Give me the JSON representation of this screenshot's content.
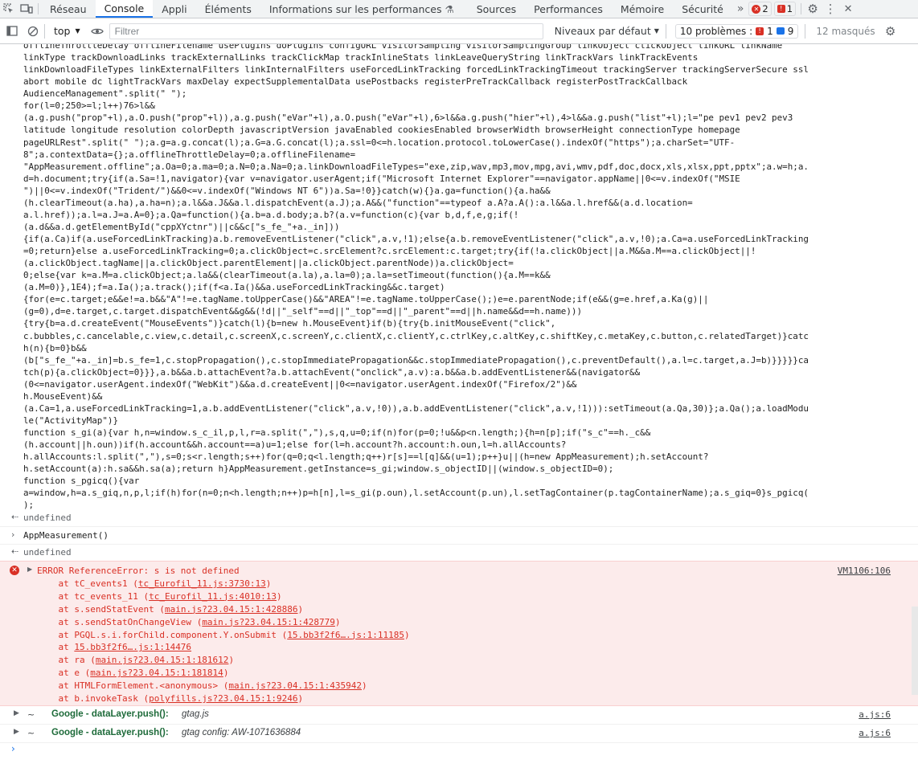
{
  "tabs": [
    "Réseau",
    "Console",
    "Appli",
    "Éléments",
    "Informations sur les performances",
    "Sources",
    "Performances",
    "Mémoire",
    "Sécurité"
  ],
  "active_tab": "Console",
  "badges": {
    "errors": "2",
    "warnings": "1"
  },
  "toolbar": {
    "context": "top",
    "filter_placeholder": "Filtrer",
    "levels": "Niveaux par défaut",
    "problems_label": "10 problèmes :",
    "problems_errors": "1",
    "problems_info": "9",
    "hidden": "12 masqués"
  },
  "code_text": "offlineThrottleDelay offlineFilename usePlugins doPlugins configURL visitorSampling visitorSamplingGroup linkObject clickObject linkURL linkName\nlinkType trackDownloadLinks trackExternalLinks trackClickMap trackInlineStats linkLeaveQueryString linkTrackVars linkTrackEvents\nlinkDownloadFileTypes linkExternalFilters linkInternalFilters useForcedLinkTracking forcedLinkTrackingTimeout trackingServer trackingServerSecure ssl\nabort mobile dc lightTrackVars maxDelay expectSupplementalData usePostbacks registerPreTrackCallback registerPostTrackCallback\nAudienceManagement\".split(\" \");\nfor(l=0;250>=l;l++)76>l&&\n(a.g.push(\"prop\"+l),a.O.push(\"prop\"+l)),a.g.push(\"eVar\"+l),a.O.push(\"eVar\"+l),6>l&&a.g.push(\"hier\"+l),4>l&&a.g.push(\"list\"+l);l=\"pe pev1 pev2 pev3\nlatitude longitude resolution colorDepth javascriptVersion javaEnabled cookiesEnabled browserWidth browserHeight connectionType homepage\npageURLRest\".split(\" \");a.g=a.g.concat(l);a.G=a.G.concat(l);a.ssl=0<=h.location.protocol.toLowerCase().indexOf(\"https\");a.charSet=\"UTF-\n8\";a.contextData={};a.offlineThrottleDelay=0;a.offlineFilename=\n\"AppMeasurement.offline\";a.Oa=0;a.ma=0;a.N=0;a.Na=0;a.linkDownloadFileTypes=\"exe,zip,wav,mp3,mov,mpg,avi,wmv,pdf,doc,docx,xls,xlsx,ppt,pptx\";a.w=h;a.\nd=h.document;try{if(a.Sa=!1,navigator){var v=navigator.userAgent;if(\"Microsoft Internet Explorer\"==navigator.appName||0<=v.indexOf(\"MSIE\n\")||0<=v.indexOf(\"Trident/\")&&0<=v.indexOf(\"Windows NT 6\"))a.Sa=!0}}catch(w){}a.ga=function(){a.ha&&\n(h.clearTimeout(a.ha),a.ha=n);a.l&&a.J&&a.l.dispatchEvent(a.J);a.A&&(\"function\"==typeof a.A?a.A():a.l&&a.l.href&&(a.d.location=\na.l.href));a.l=a.J=a.A=0};a.Qa=function(){a.b=a.d.body;a.b?(a.v=function(c){var b,d,f,e,g;if(!\n(a.d&&a.d.getElementById(\"cppXYctnr\")||c&&c[\"s_fe_\"+a._in]))\n{if(a.Ca)if(a.useForcedLinkTracking)a.b.removeEventListener(\"click\",a.v,!1);else{a.b.removeEventListener(\"click\",a.v,!0);a.Ca=a.useForcedLinkTracking\n=0;return}else a.useForcedLinkTracking=0;a.clickObject=c.srcElement?c.srcElement:c.target;try{if(!a.clickObject||a.M&&a.M==a.clickObject||!\n(a.clickObject.tagName||a.clickObject.parentElement||a.clickObject.parentNode))a.clickObject=\n0;else{var k=a.M=a.clickObject;a.la&&(clearTimeout(a.la),a.la=0);a.la=setTimeout(function(){a.M==k&&\n(a.M=0)},1E4);f=a.Ia();a.track();if(f<a.Ia()&&a.useForcedLinkTracking&&c.target)\n{for(e=c.target;e&&e!=a.b&&\"A\"!=e.tagName.toUpperCase()&&\"AREA\"!=e.tagName.toUpperCase();)e=e.parentNode;if(e&&(g=e.href,a.Ka(g)||\n(g=0),d=e.target,c.target.dispatchEvent&&g&&(!d||\"_self\"==d||\"_top\"==d||\"_parent\"==d||h.name&&d==h.name)))\n{try{b=a.d.createEvent(\"MouseEvents\")}catch(l){b=new h.MouseEvent}if(b){try{b.initMouseEvent(\"click\",\nc.bubbles,c.cancelable,c.view,c.detail,c.screenX,c.screenY,c.clientX,c.clientY,c.ctrlKey,c.altKey,c.shiftKey,c.metaKey,c.button,c.relatedTarget)}catc\nh(n){b=0}b&&\n(b[\"s_fe_\"+a._in]=b.s_fe=1,c.stopPropagation(),c.stopImmediatePropagation&&c.stopImmediatePropagation(),c.preventDefault(),a.l=c.target,a.J=b)}}}}}ca\ntch(p){a.clickObject=0}}},a.b&&a.b.attachEvent?a.b.attachEvent(\"onclick\",a.v):a.b&&a.b.addEventListener&&(navigator&&\n(0<=navigator.userAgent.indexOf(\"WebKit\")&&a.d.createEvent||0<=navigator.userAgent.indexOf(\"Firefox/2\")&&\nh.MouseEvent)&&\n(a.Ca=1,a.useForcedLinkTracking=1,a.b.addEventListener(\"click\",a.v,!0)),a.b.addEventListener(\"click\",a.v,!1))):setTimeout(a.Qa,30)};a.Qa();a.loadModu\nle(\"ActivityMap\")}\nfunction s_gi(a){var h,n=window.s_c_il,p,l,r=a.split(\",\"),s,q,u=0;if(n)for(p=0;!u&&p<n.length;){h=n[p];if(\"s_c\"==h._c&&\n(h.account||h.oun))if(h.account&&h.account==a)u=1;else for(l=h.account?h.account:h.oun,l=h.allAccounts?\nh.allAccounts:l.split(\",\"),s=0;s<r.length;s++)for(q=0;q<l.length;q++)r[s]==l[q]&&(u=1);p++}u||(h=new AppMeasurement);h.setAccount?\nh.setAccount(a):h.sa&&h.sa(a);return h}AppMeasurement.getInstance=s_gi;window.s_objectID||(window.s_objectID=0);\nfunction s_pgicq(){var\na=window,h=a.s_giq,n,p,l;if(h)for(n=0;n<h.length;n++)p=h[n],l=s_gi(p.oun),l.setAccount(p.un),l.setTagContainer(p.tagContainerName);a.s_giq=0}s_pgicq(\n);",
  "undefined_1": "undefined",
  "input_cmd": "AppMeasurement()",
  "undefined_2": "undefined",
  "error": {
    "title": "ERROR ReferenceError: s is not defined",
    "source": "VM1106:106",
    "frames": [
      {
        "fn": "at tC_events1 ",
        "loc": "tc_Eurofil_11.js:3730:13"
      },
      {
        "fn": "at tc_events_11 ",
        "loc": "tc_Eurofil_11.js:4010:13"
      },
      {
        "fn": "at s.sendStatEvent ",
        "loc": "main.js?23.04.15:1:428886"
      },
      {
        "fn": "at s.sendStatOnChangeView ",
        "loc": "main.js?23.04.15:1:428779"
      },
      {
        "fn": "at PGQL.s.i.forChild.component.Y.onSubmit ",
        "loc": "15.bb3f2f6….js:1:11185"
      },
      {
        "fn": "at ",
        "loc": "15.bb3f2f6….js:1:14476"
      },
      {
        "fn": "at ra ",
        "loc": "main.js?23.04.15:1:181612"
      },
      {
        "fn": "at e ",
        "loc": "main.js?23.04.15:1:181814"
      },
      {
        "fn": "at HTMLFormElement.<anonymous> ",
        "loc": "main.js?23.04.15:1:435942"
      },
      {
        "fn": "at b.invokeTask ",
        "loc": "polyfills.js?23.04.15:1:9246"
      }
    ]
  },
  "google_logs": [
    {
      "tilde": "~",
      "label": "Google - dataLayer.push():",
      "message": "gtag.js",
      "source": "a.js:6"
    },
    {
      "tilde": "~",
      "label": "Google - dataLayer.push():",
      "message": "gtag config: AW-1071636884",
      "source": "a.js:6"
    }
  ],
  "prompt_symbol": "›"
}
